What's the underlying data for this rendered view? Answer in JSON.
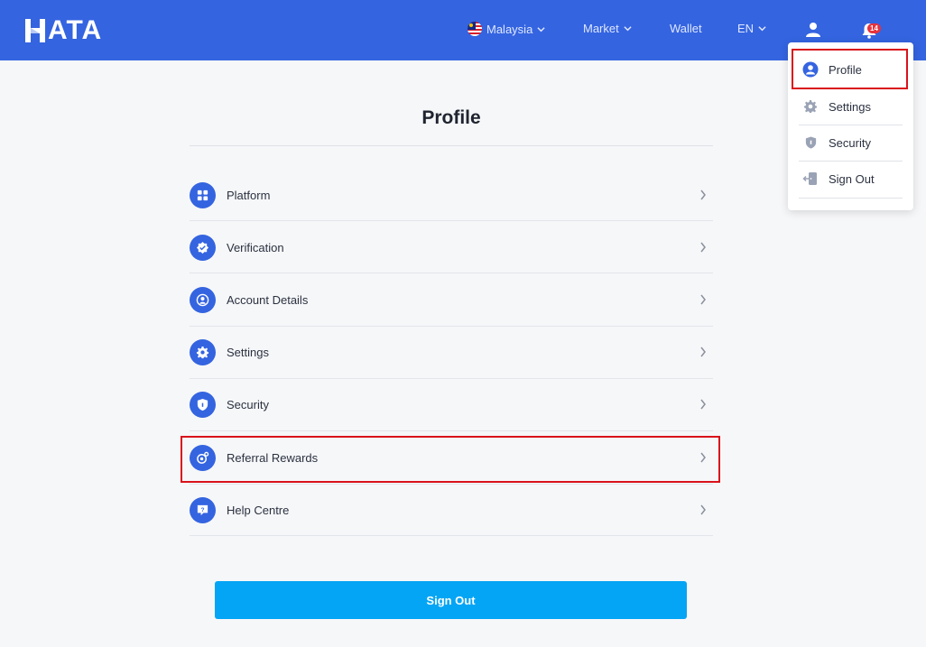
{
  "header": {
    "logo_text": "ATA",
    "nav": {
      "country": "Malaysia",
      "market": "Market",
      "wallet": "Wallet",
      "language": "EN"
    },
    "notification_count": "14"
  },
  "dropdown": {
    "items": [
      {
        "label": "Profile",
        "icon": "user-circle-icon"
      },
      {
        "label": "Settings",
        "icon": "gear-icon"
      },
      {
        "label": "Security",
        "icon": "shield-icon"
      },
      {
        "label": "Sign Out",
        "icon": "sign-out-icon"
      }
    ]
  },
  "page": {
    "title": "Profile",
    "menu": [
      {
        "label": "Platform",
        "icon": "grid-icon"
      },
      {
        "label": "Verification",
        "icon": "verified-badge-icon"
      },
      {
        "label": "Account Details",
        "icon": "account-icon"
      },
      {
        "label": "Settings",
        "icon": "gear-icon"
      },
      {
        "label": "Security",
        "icon": "shield-icon"
      },
      {
        "label": "Referral Rewards",
        "icon": "referral-icon"
      },
      {
        "label": "Help Centre",
        "icon": "help-icon"
      }
    ],
    "sign_out_button": "Sign Out"
  },
  "colors": {
    "header_bg": "#3464e0",
    "accent_blue": "#3464e0",
    "signout_bg": "#04a5f5",
    "highlight_red": "#d9131b",
    "badge_red": "#e8323c"
  }
}
